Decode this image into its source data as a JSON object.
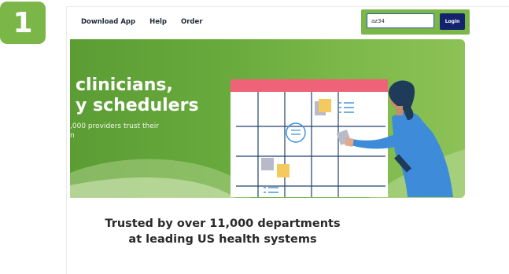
{
  "step": {
    "number": "1"
  },
  "nav": {
    "items": [
      "Download App",
      "Help",
      "Order"
    ]
  },
  "login": {
    "input_value": "az34",
    "button_label": "Login"
  },
  "hero": {
    "title_line1": "clinicians,",
    "title_line2": "y schedulers",
    "subtitle_line1": ",000 providers trust their",
    "subtitle_line2": "n"
  },
  "tagline": {
    "line1": "Trusted by over 11,000 departments",
    "line2": "at leading US health systems"
  },
  "colors": {
    "accent_green": "#7ab648",
    "login_button": "#14236e",
    "calendar_header": "#ef6378",
    "calendar_grid": "#22406e"
  }
}
